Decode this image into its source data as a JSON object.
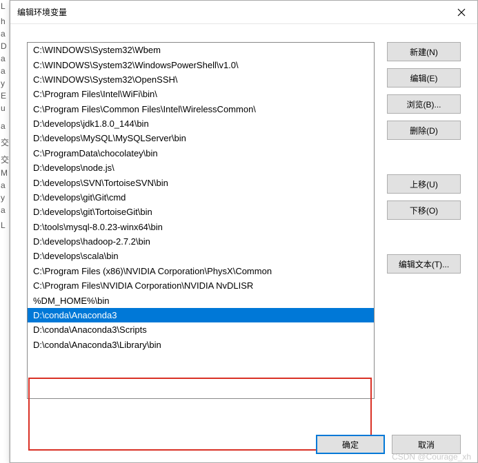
{
  "dialog": {
    "title": "编辑环境变量"
  },
  "list": {
    "items": [
      "C:\\WINDOWS\\System32\\Wbem",
      "C:\\WINDOWS\\System32\\WindowsPowerShell\\v1.0\\",
      "C:\\WINDOWS\\System32\\OpenSSH\\",
      "C:\\Program Files\\Intel\\WiFi\\bin\\",
      "C:\\Program Files\\Common Files\\Intel\\WirelessCommon\\",
      "D:\\develops\\jdk1.8.0_144\\bin",
      "D:\\develops\\MySQL\\MySQLServer\\bin",
      "C:\\ProgramData\\chocolatey\\bin",
      "D:\\develops\\node.js\\",
      "D:\\develops\\SVN\\TortoiseSVN\\bin",
      "D:\\develops\\git\\Git\\cmd",
      "D:\\develops\\git\\TortoiseGit\\bin",
      "D:\\tools\\mysql-8.0.23-winx64\\bin",
      "D:\\develops\\hadoop-2.7.2\\bin",
      "D:\\develops\\scala\\bin",
      "C:\\Program Files (x86)\\NVIDIA Corporation\\PhysX\\Common",
      "C:\\Program Files\\NVIDIA Corporation\\NVIDIA NvDLISR",
      "%DM_HOME%\\bin",
      "D:\\conda\\Anaconda3",
      "D:\\conda\\Anaconda3\\Scripts",
      "D:\\conda\\Anaconda3\\Library\\bin"
    ],
    "selected_index": 18
  },
  "buttons": {
    "new": "新建(N)",
    "edit": "编辑(E)",
    "browse": "浏览(B)...",
    "delete": "删除(D)",
    "move_up": "上移(U)",
    "move_down": "下移(O)",
    "edit_text": "编辑文本(T)...",
    "ok": "确定",
    "cancel": "取消"
  },
  "bg_chars": [
    "L",
    "",
    "h",
    "a",
    "D",
    "a",
    "a",
    "y",
    "E",
    "u",
    "",
    "",
    "a",
    "",
    "交",
    "",
    "交",
    "M",
    "a",
    "y",
    "a",
    "",
    "L"
  ],
  "watermark": "CSDN @Courage_xh"
}
